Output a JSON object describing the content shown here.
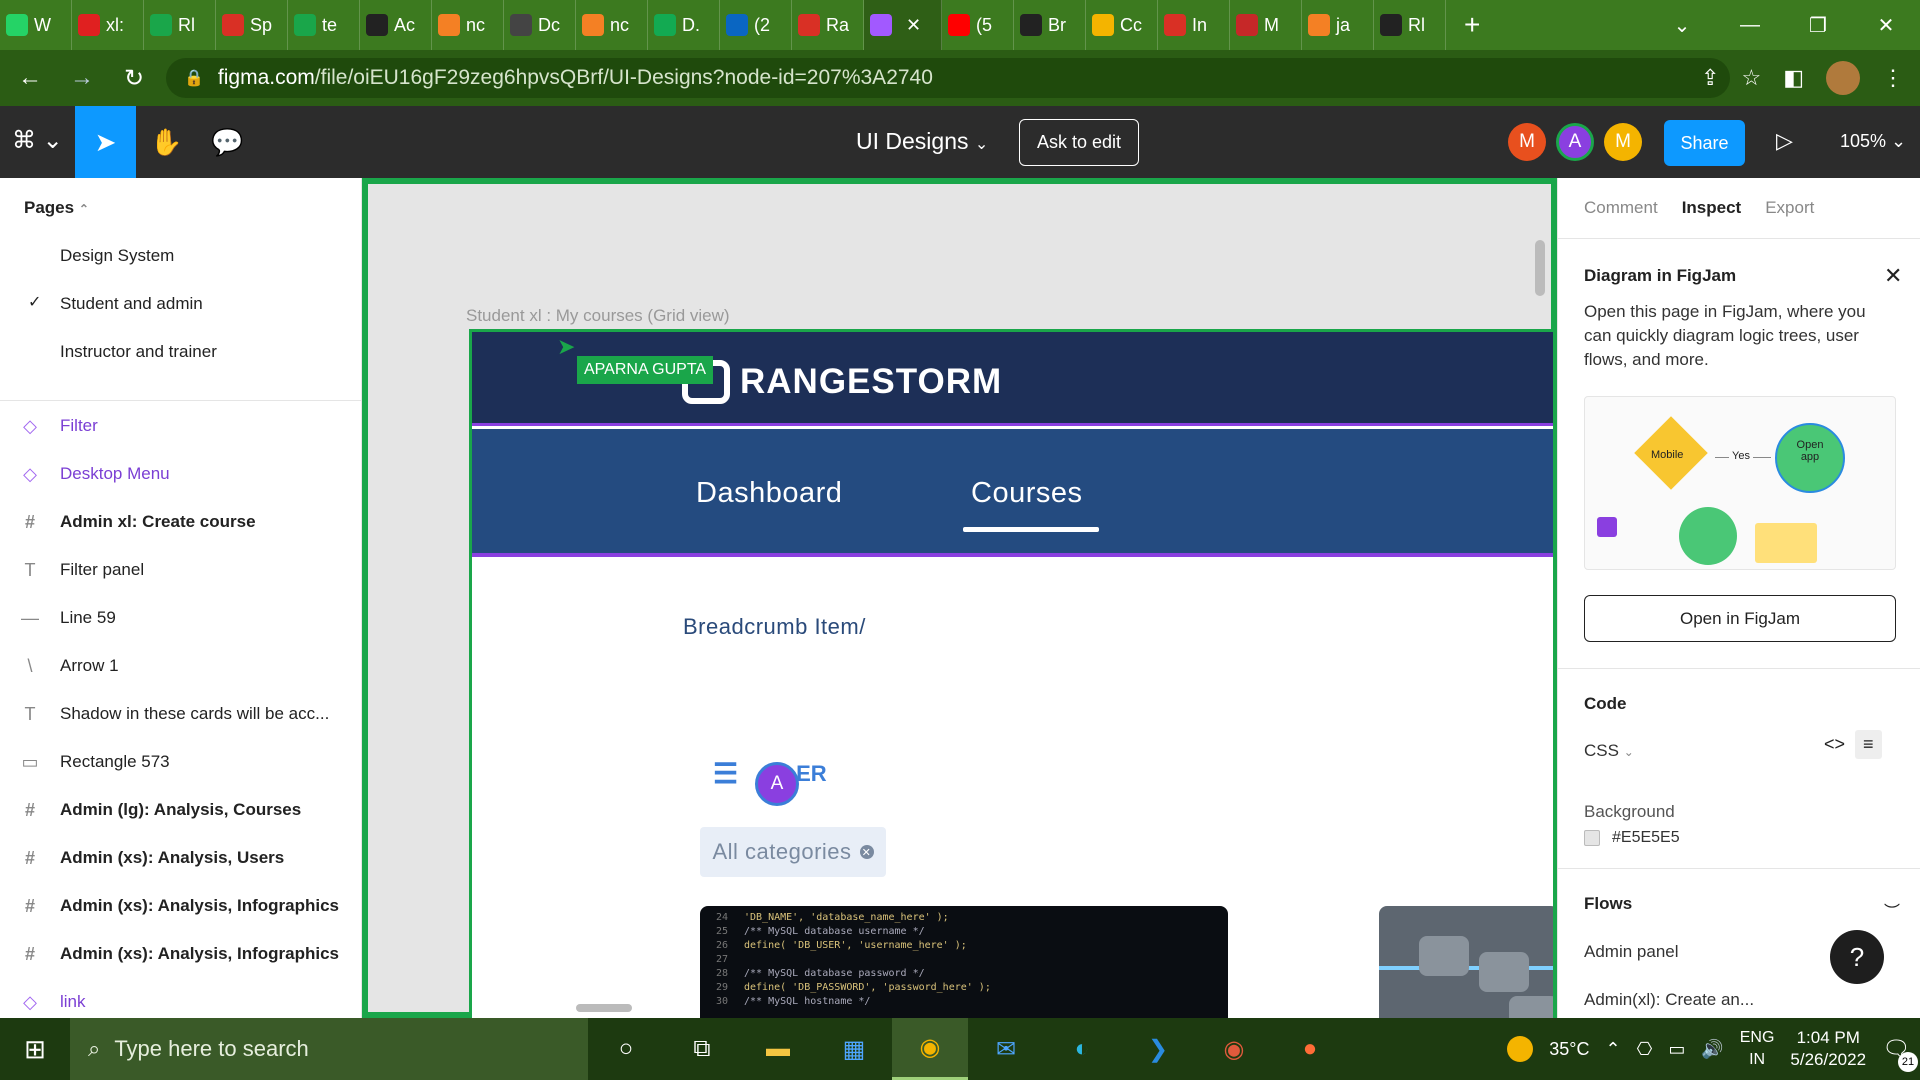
{
  "browser": {
    "tabs": [
      {
        "label": "W",
        "color": "#25d366",
        "icon": "whatsapp-icon"
      },
      {
        "label": "xl:",
        "color": "#e02020",
        "icon": "notion-icon"
      },
      {
        "label": "Rl",
        "color": "#1aa64a",
        "icon": "sheets-plus-icon"
      },
      {
        "label": "Sp",
        "color": "#d93025",
        "icon": "gmail-icon"
      },
      {
        "label": "te",
        "color": "#1aa64a",
        "icon": "sheets-plus-icon"
      },
      {
        "label": "Ac",
        "color": "#222",
        "icon": "github-icon"
      },
      {
        "label": "nc",
        "color": "#f48024",
        "icon": "stackoverflow-icon"
      },
      {
        "label": "Dc",
        "color": "#444",
        "icon": "terminal-icon"
      },
      {
        "label": "nc",
        "color": "#f48024",
        "icon": "stackoverflow-icon"
      },
      {
        "label": "D.",
        "color": "#13aa52",
        "icon": "mongodb-icon"
      },
      {
        "label": "(2",
        "color": "#0a66c2",
        "icon": "linkedin-icon"
      },
      {
        "label": "Ra",
        "color": "#d93025",
        "icon": "gmail-icon"
      },
      {
        "label": "",
        "color": "#a259ff",
        "icon": "figma-icon",
        "active": true
      },
      {
        "label": "(5",
        "color": "#ff0000",
        "icon": "youtube-icon"
      },
      {
        "label": "Br",
        "color": "#222",
        "icon": "github-icon"
      },
      {
        "label": "Cc",
        "color": "#f4b400",
        "icon": "extension-icon"
      },
      {
        "label": "In",
        "color": "#d93025",
        "icon": "gmail-icon"
      },
      {
        "label": "M",
        "color": "#c62828",
        "icon": "mailchimp-icon"
      },
      {
        "label": "ja",
        "color": "#f48024",
        "icon": "stackoverflow-icon"
      },
      {
        "label": "Rl",
        "color": "#222",
        "icon": "github-icon"
      }
    ],
    "url_host": "figma.com",
    "url_path": "/file/oiEU16gF29zeg6hpvsQBrf/UI-Designs?node-id=207%3A2740"
  },
  "figma": {
    "file_name": "UI Designs",
    "ask_to_edit": "Ask to edit",
    "presence": [
      {
        "initial": "M",
        "color": "#e8501e"
      },
      {
        "initial": "A",
        "color": "#8a3fe0"
      },
      {
        "initial": "M",
        "color": "#f4b400"
      }
    ],
    "share": "Share",
    "zoom": "105%"
  },
  "left_panel": {
    "pages_header": "Pages",
    "pages": [
      "Design System",
      "Student and admin",
      "Instructor and trainer"
    ],
    "layers": [
      {
        "label": "Filter",
        "icon": "◇",
        "type": "comp"
      },
      {
        "label": "Desktop Menu",
        "icon": "◇",
        "type": "comp"
      },
      {
        "label": "Admin xl: Create course",
        "icon": "#",
        "type": "bold"
      },
      {
        "label": "Filter panel",
        "icon": "T",
        "type": "plain"
      },
      {
        "label": "Line 59",
        "icon": "—",
        "type": "plain"
      },
      {
        "label": "Arrow 1",
        "icon": "\\",
        "type": "plain"
      },
      {
        "label": "Shadow in these cards will be acc...",
        "icon": "T",
        "type": "plain"
      },
      {
        "label": "Rectangle 573",
        "icon": "▭",
        "type": "plain"
      },
      {
        "label": "Admin (lg): Analysis, Courses",
        "icon": "#",
        "type": "bold"
      },
      {
        "label": "Admin (xs): Analysis, Users",
        "icon": "#",
        "type": "bold"
      },
      {
        "label": "Admin (xs): Analysis, Infographics",
        "icon": "#",
        "type": "bold"
      },
      {
        "label": "Admin (xs): Analysis, Infographics",
        "icon": "#",
        "type": "bold"
      },
      {
        "label": "link",
        "icon": "◇",
        "type": "comp"
      }
    ]
  },
  "canvas": {
    "frame_label": "Student xl : My courses (Grid view)",
    "cursor_tag": "APARNA GUPTA",
    "logo_text": "RANGESTORM",
    "nav": [
      "Dashboard",
      "Courses"
    ],
    "breadcrumb": "Breadcrumb Item/",
    "filter_label": "ER",
    "collab_initial": "A",
    "chip_label": "All categories",
    "code_lines": [
      {
        "n": "24",
        "t": "        'DB_NAME', 'database_name_here' );"
      },
      {
        "n": "25",
        "t": "/** MySQL database username */"
      },
      {
        "n": "26",
        "t": "define( 'DB_USER', 'username_here' );"
      },
      {
        "n": "27",
        "t": ""
      },
      {
        "n": "28",
        "t": "/** MySQL database password */"
      },
      {
        "n": "29",
        "t": "define( 'DB_PASSWORD', 'password_here' );"
      },
      {
        "n": "30",
        "t": "/** MySQL hostname */"
      }
    ]
  },
  "right_panel": {
    "tabs": [
      "Comment",
      "Inspect",
      "Export"
    ],
    "active_tab": "Inspect",
    "diagram_title": "Diagram in FigJam",
    "diagram_desc": "Open this page in FigJam, where you can quickly diagram logic trees, user flows, and more.",
    "diagram_labels": {
      "mobile": "Mobile",
      "yes": "Yes",
      "open_app": "Open app"
    },
    "open_figjam": "Open in FigJam",
    "code_title": "Code",
    "code_lang": "CSS",
    "background_title": "Background",
    "background_value": "#E5E5E5",
    "flows_title": "Flows",
    "flows": [
      "Admin panel",
      "Admin(xl): Create an..."
    ]
  },
  "taskbar": {
    "search_placeholder": "Type here to search",
    "temperature": "35°C",
    "lang_top": "ENG",
    "lang_bottom": "IN",
    "time": "1:04 PM",
    "date": "5/26/2022",
    "notif_count": "21"
  }
}
